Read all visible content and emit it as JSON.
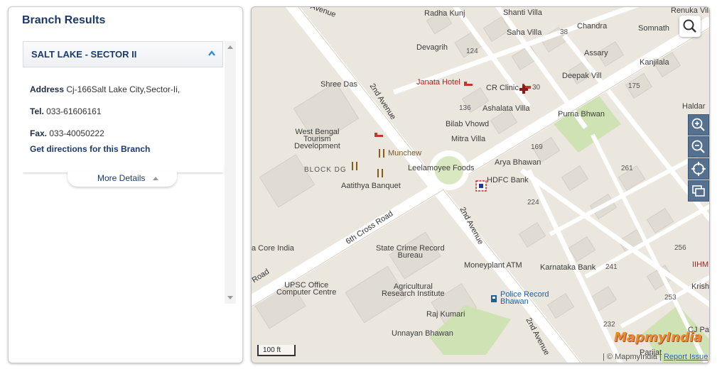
{
  "panel": {
    "title": "Branch Results",
    "branch": {
      "name": "SALT LAKE - SECTOR II",
      "address_label": "Address",
      "address": "Cj-166Salt Lake City,Sector-Ii,",
      "tel_label": "Tel.",
      "tel": "033-61606161",
      "fax_label": "Fax.",
      "fax": "033-40050222",
      "directions": "Get directions for this Branch",
      "more_details": "More Details"
    }
  },
  "map": {
    "labels": {
      "radha_kunj": "Radha Kunj",
      "shanti_villa": "Shanti Villa",
      "chandra": "Chandra",
      "renuka": "Renuka Villa",
      "somnath": "Somnath",
      "saha_villa": "Saha Villa",
      "n38": "38",
      "devagrih": "Devagrih",
      "n124": "124",
      "assary": "Assary",
      "kanjilala": "Kanjilala",
      "shree_das": "Shree Das",
      "janata_hotel": "Janata Hotel",
      "cr_clinic": "CR Clinic",
      "n30": "30",
      "deepak_villa": "Deepak Vill",
      "n175": "175",
      "haldar": "Haldar",
      "n136": "136",
      "ashalata": "Ashalata Villa",
      "purna": "Purna Bhwan",
      "bilab": "Bilab Vhowd",
      "mitra": "Mitra Villa",
      "wb_tourism": "West Bengal\nTourism\nDevelopment",
      "munchew": "Munchew",
      "n169": "169",
      "arya": "Arya Bhawan",
      "block_dg": "BLOCK DG",
      "leelamoyee": "Leelamoyee Foods",
      "n261": "261",
      "aatithya": "Aatithya Banquet",
      "hdfc": "HDFC Bank",
      "n224": "224",
      "core_india": "a Core India",
      "state_crime": "State Crime Record\nBureau",
      "n256": "256",
      "moneyplant": "Moneyplant ATM",
      "karnataka": "Karnataka Bank",
      "n241": "241",
      "iihm": "IIHM",
      "upsc": "UPSC Office\nComputer Centre",
      "agri": "Agricultural\nResearch Institute",
      "police": "Police Record\nBhawan",
      "krish": "Krish",
      "n253": "253",
      "raj": "Raj Kumari",
      "n232": "232",
      "cj_park": "CJ Par",
      "unnayan": "Unnayan Bhawan",
      "parijat": "Parijat",
      "road_2nd_avenue_a": "2nd Avenue",
      "road_2nd_avenue_b": "2nd Avenue",
      "road_2nd_avenue_c": "2nd Avenue",
      "road_6th_cross": "6th Cross Road",
      "road_top": "Avenue",
      "road_left": "Road"
    },
    "scale": "100 ft",
    "copyright_prefix": "| © MapmyIndia |",
    "report_issue": "Report Issue",
    "brand": "MapmyIndia"
  }
}
